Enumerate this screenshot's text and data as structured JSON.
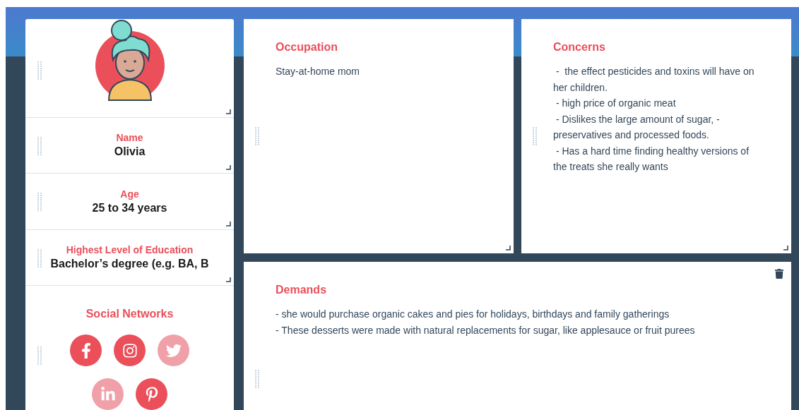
{
  "profile": {
    "fields": [
      {
        "label": "Name",
        "value": "Olivia"
      },
      {
        "label": "Age",
        "value": "25 to 34 years"
      },
      {
        "label": "Highest Level of Education",
        "value": "Bachelor’s degree (e.g. BA, B"
      }
    ],
    "social": {
      "title": "Social Networks",
      "networks": [
        {
          "kind": "facebook",
          "active": true
        },
        {
          "kind": "instagram",
          "active": true
        },
        {
          "kind": "twitter",
          "active": false
        },
        {
          "kind": "linkedin",
          "active": false
        },
        {
          "kind": "pinterest",
          "active": true
        }
      ]
    }
  },
  "occupation": {
    "title": "Occupation",
    "lines": [
      "Stay-at-home mom"
    ]
  },
  "concerns": {
    "title": "Concerns",
    "lines": [
      " -  the effect pesticides and toxins will have on her children.",
      " - high price of organic meat",
      " - Dislikes the large amount of sugar, - preservatives and processed foods.",
      " - Has a hard time finding healthy versions of the treats she really wants"
    ]
  },
  "demands": {
    "title": "Demands",
    "lines": [
      "- she would purchase organic cakes and pies for holidays, birthdays and family gatherings",
      "- These desserts were made with natural replacements for sugar, like applesauce or fruit purees"
    ]
  }
}
